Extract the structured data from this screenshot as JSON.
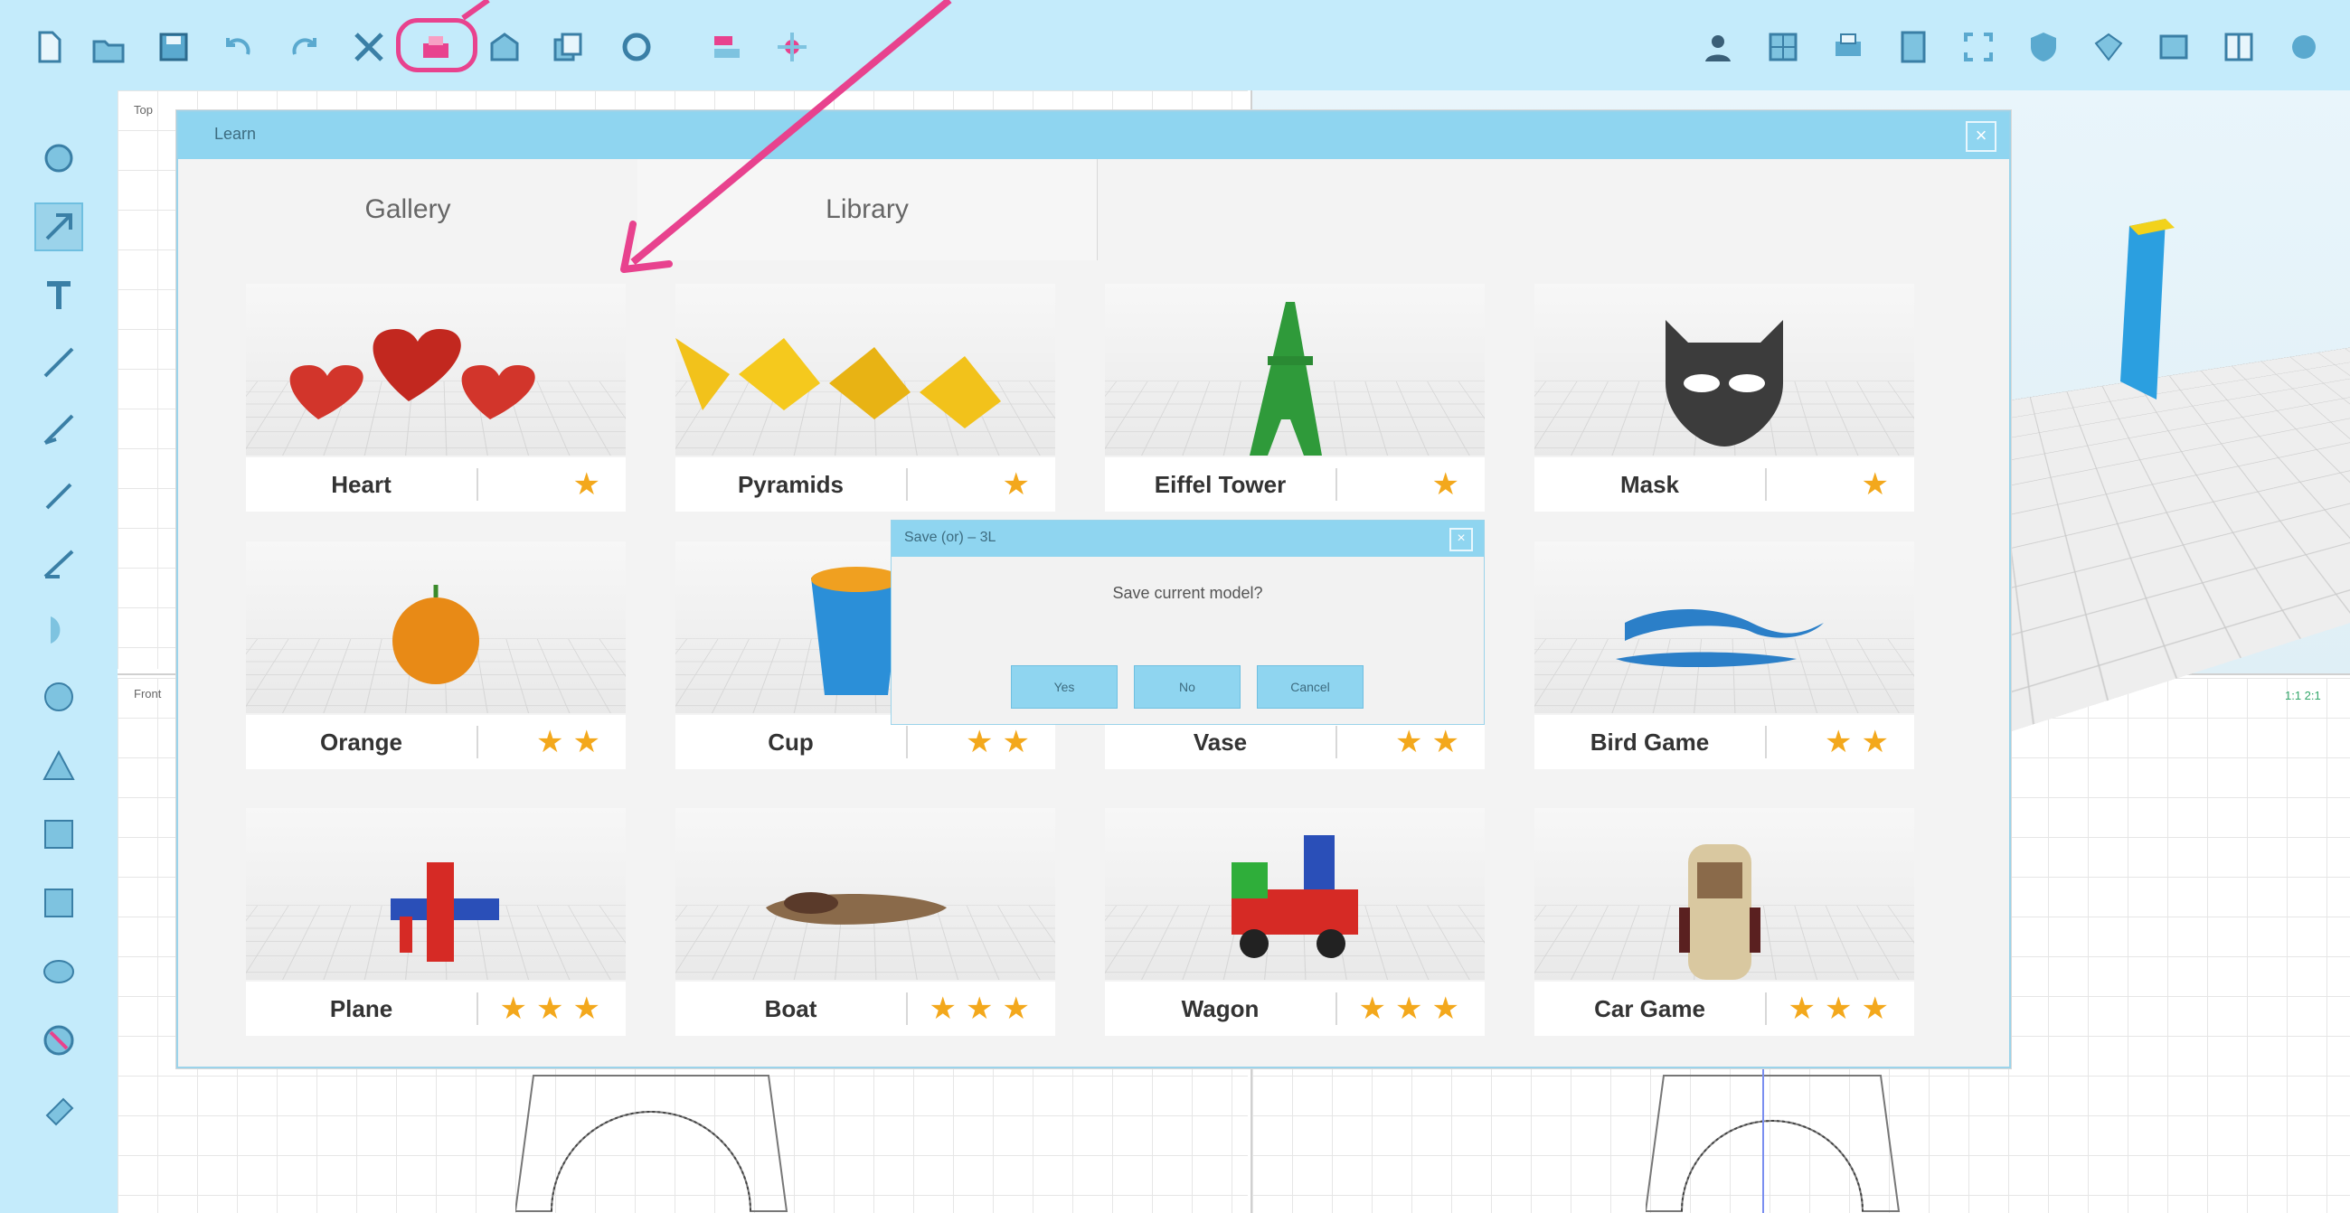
{
  "colors": {
    "accent": "#e8428e",
    "dialog_title": "#8fd5f0",
    "star": "#f3a81c",
    "background": "#bfe8fa"
  },
  "toolbar": {
    "left_icons": [
      "new-icon",
      "open-icon",
      "save-icon",
      "undo-icon",
      "redo-icon",
      "tools-icon",
      "learn-icon",
      "building-icon",
      "copy-icon",
      "refresh-icon",
      "chart-icon",
      "settings-icon"
    ],
    "right_icons": [
      "user-icon",
      "grid-icon",
      "print-icon",
      "page-icon",
      "fullscreen-icon",
      "shield-icon",
      "gem-icon",
      "image-icon",
      "layout-icon",
      "help-icon"
    ]
  },
  "left_tools": [
    "hand-icon",
    "select-icon",
    "text-icon",
    "line-icon",
    "pen-icon",
    "brush-icon",
    "curve-icon",
    "arc-icon",
    "circle-icon",
    "triangle-icon",
    "square-icon",
    "rectangle-icon",
    "ellipse-icon",
    "bucket-icon",
    "eraser-icon"
  ],
  "workspace": {
    "view_top": "Top",
    "view_front": "Front",
    "readout": "1:1  2:1"
  },
  "learn_dialog": {
    "title": "Learn",
    "close": "×",
    "tabs": [
      "Gallery",
      "Library"
    ],
    "items": [
      {
        "name": "Heart",
        "stars": "★"
      },
      {
        "name": "Pyramids",
        "stars": "★"
      },
      {
        "name": "Eiffel Tower",
        "stars": "★"
      },
      {
        "name": "Mask",
        "stars": "★"
      },
      {
        "name": "Orange",
        "stars": "★★"
      },
      {
        "name": "Cup",
        "stars": "★★"
      },
      {
        "name": "Vase",
        "stars": "★★"
      },
      {
        "name": "Bird Game",
        "stars": "★★"
      },
      {
        "name": "Plane",
        "stars": "★★★"
      },
      {
        "name": "Boat",
        "stars": "★★★"
      },
      {
        "name": "Wagon",
        "stars": "★★★"
      },
      {
        "name": "Car Game",
        "stars": "★★★"
      }
    ]
  },
  "save_dialog": {
    "title": "Save (or) – 3L",
    "close": "×",
    "message": "Save current model?",
    "buttons": [
      "Yes",
      "No",
      "Cancel"
    ]
  }
}
